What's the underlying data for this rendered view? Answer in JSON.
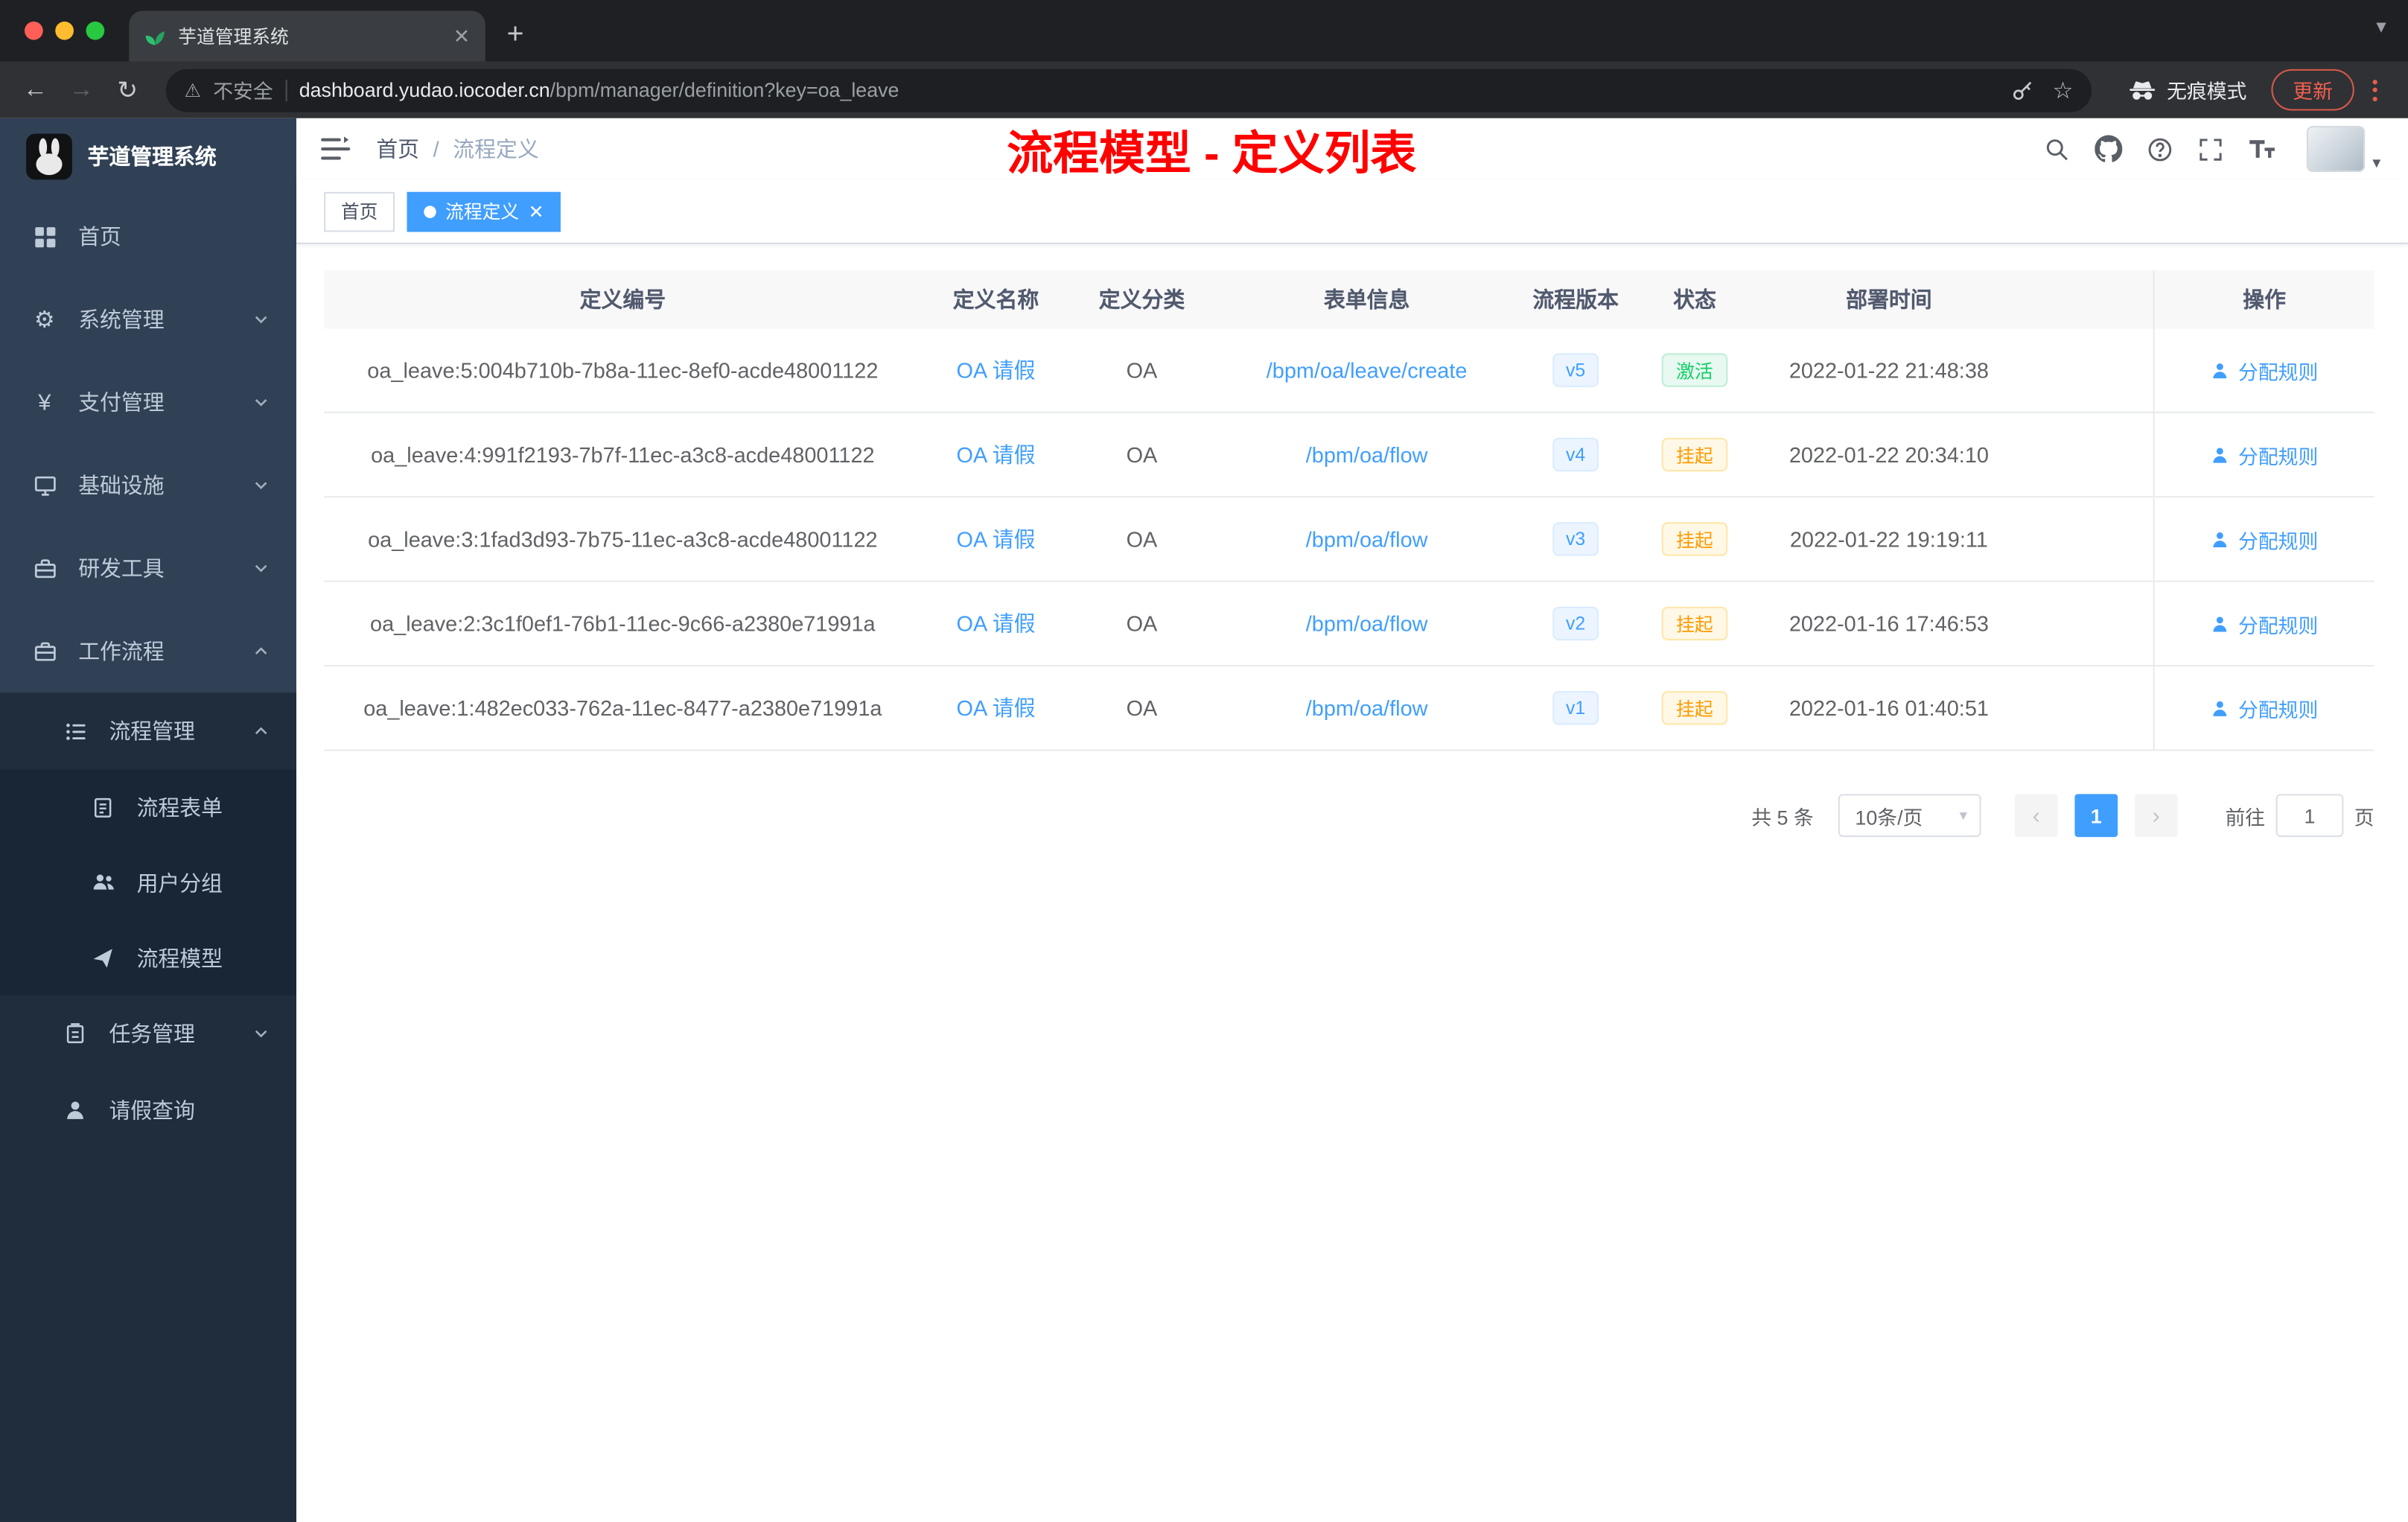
{
  "browser": {
    "tab_title": "芋道管理系统",
    "security_label": "不安全",
    "url_host": "dashboard.yudao.iocoder.cn",
    "url_path": "/bpm/manager/definition?key=oa_leave",
    "incognito_label": "无痕模式",
    "update_label": "更新"
  },
  "sidebar": {
    "app_title": "芋道管理系统",
    "items": {
      "home": "首页",
      "system": "系统管理",
      "payment": "支付管理",
      "infrastructure": "基础设施",
      "devtools": "研发工具",
      "workflow": "工作流程",
      "process_mgmt": "流程管理",
      "process_form": "流程表单",
      "user_group": "用户分组",
      "process_model": "流程模型",
      "task_mgmt": "任务管理",
      "leave_query": "请假查询"
    }
  },
  "navbar": {
    "breadcrumb_home": "首页",
    "breadcrumb_sep": "/",
    "breadcrumb_current": "流程定义",
    "annotation": "流程模型 - 定义列表"
  },
  "tags": {
    "home": "首页",
    "active": "流程定义"
  },
  "table": {
    "columns": [
      "定义编号",
      "定义名称",
      "定义分类",
      "表单信息",
      "流程版本",
      "状态",
      "部署时间",
      "操作"
    ],
    "rows": [
      {
        "id": "oa_leave:5:004b710b-7b8a-11ec-8ef0-acde48001122",
        "name": "OA 请假",
        "category": "OA",
        "form": "/bpm/oa/leave/create",
        "version": "v5",
        "status": "激活",
        "time": "2022-01-22 21:48:38",
        "action": "分配规则"
      },
      {
        "id": "oa_leave:4:991f2193-7b7f-11ec-a3c8-acde48001122",
        "name": "OA 请假",
        "category": "OA",
        "form": "/bpm/oa/flow",
        "version": "v4",
        "status": "挂起",
        "time": "2022-01-22 20:34:10",
        "action": "分配规则"
      },
      {
        "id": "oa_leave:3:1fad3d93-7b75-11ec-a3c8-acde48001122",
        "name": "OA 请假",
        "category": "OA",
        "form": "/bpm/oa/flow",
        "version": "v3",
        "status": "挂起",
        "time": "2022-01-22 19:19:11",
        "action": "分配规则"
      },
      {
        "id": "oa_leave:2:3c1f0ef1-76b1-11ec-9c66-a2380e71991a",
        "name": "OA 请假",
        "category": "OA",
        "form": "/bpm/oa/flow",
        "version": "v2",
        "status": "挂起",
        "time": "2022-01-16 17:46:53",
        "action": "分配规则"
      },
      {
        "id": "oa_leave:1:482ec033-762a-11ec-8477-a2380e71991a",
        "name": "OA 请假",
        "category": "OA",
        "form": "/bpm/oa/flow",
        "version": "v1",
        "status": "挂起",
        "time": "2022-01-16 01:40:51",
        "action": "分配规则"
      }
    ]
  },
  "pagination": {
    "total": "共 5 条",
    "page_size": "10条/页",
    "current_page": "1",
    "prev": "‹",
    "next": "›",
    "goto_label": "前往",
    "goto_value": "1",
    "unit_label": "页"
  }
}
